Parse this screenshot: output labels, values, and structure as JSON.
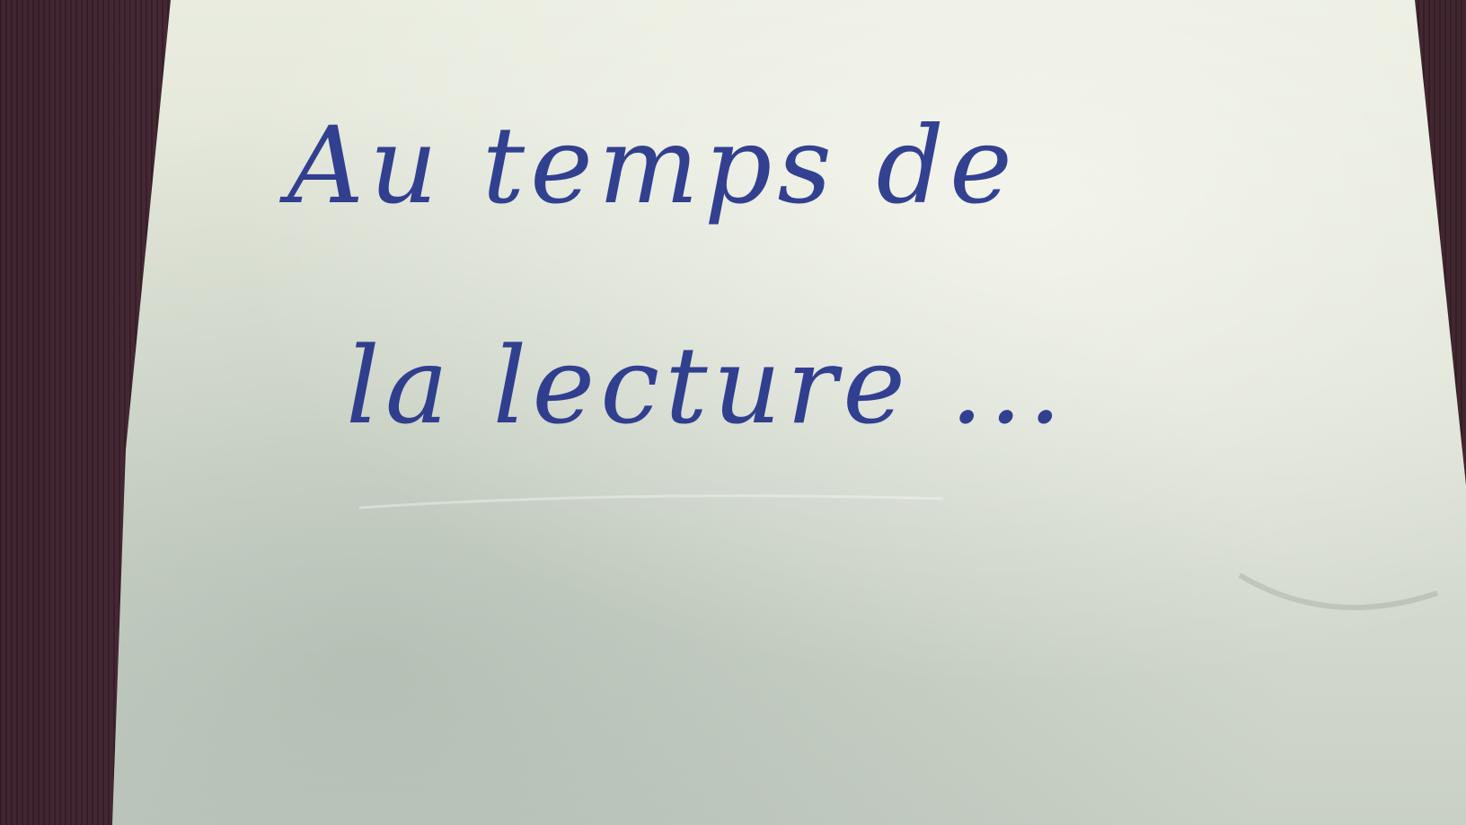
{
  "handwriting": {
    "line1": "Au temps de",
    "line2": "la lecture ..."
  },
  "colors": {
    "ink": "#1f2e88",
    "paper": "#e3e7da",
    "background": "#3f2230"
  }
}
